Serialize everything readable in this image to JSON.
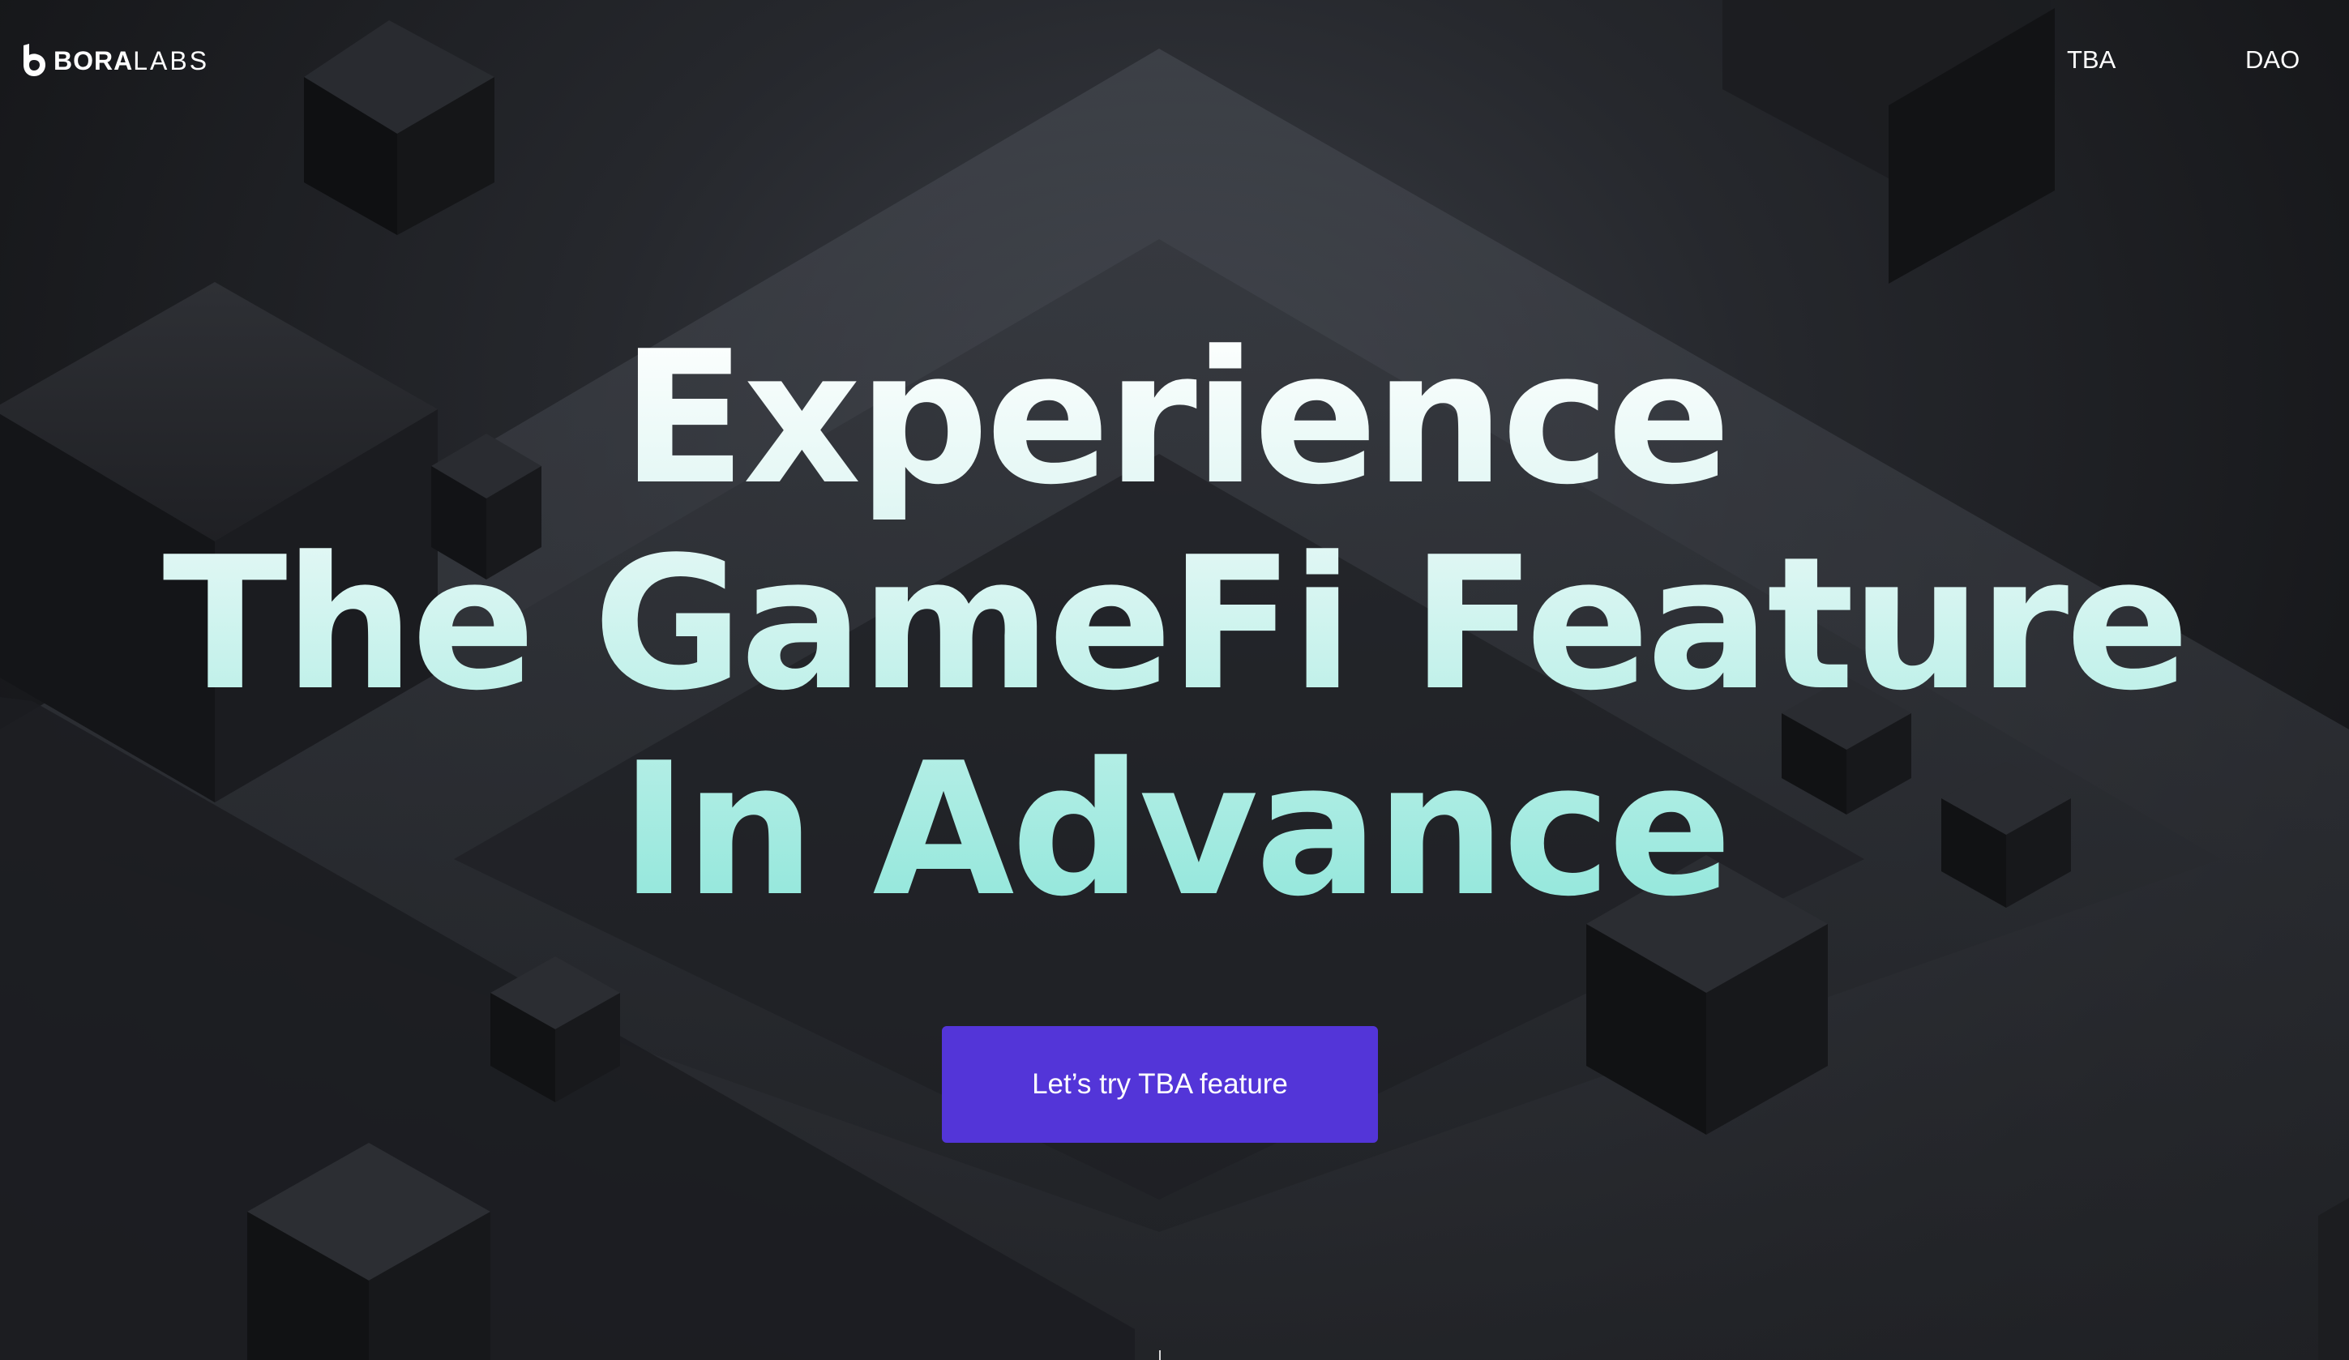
{
  "brand": {
    "name_bold": "BORA",
    "name_light": "LABS",
    "logo_icon": "bora-b-icon"
  },
  "nav": {
    "items": [
      {
        "label": "TBA"
      },
      {
        "label": "DAO"
      }
    ]
  },
  "hero": {
    "lines": [
      "Experience",
      "The GameFi Feature",
      "In Advance"
    ],
    "cta_label": "Let’s try TBA feature"
  },
  "colors": {
    "background": "#1a1b1e",
    "accent": "#5335d8",
    "headline_top": "#f3fbfb",
    "headline_bottom": "#8fe6da"
  }
}
